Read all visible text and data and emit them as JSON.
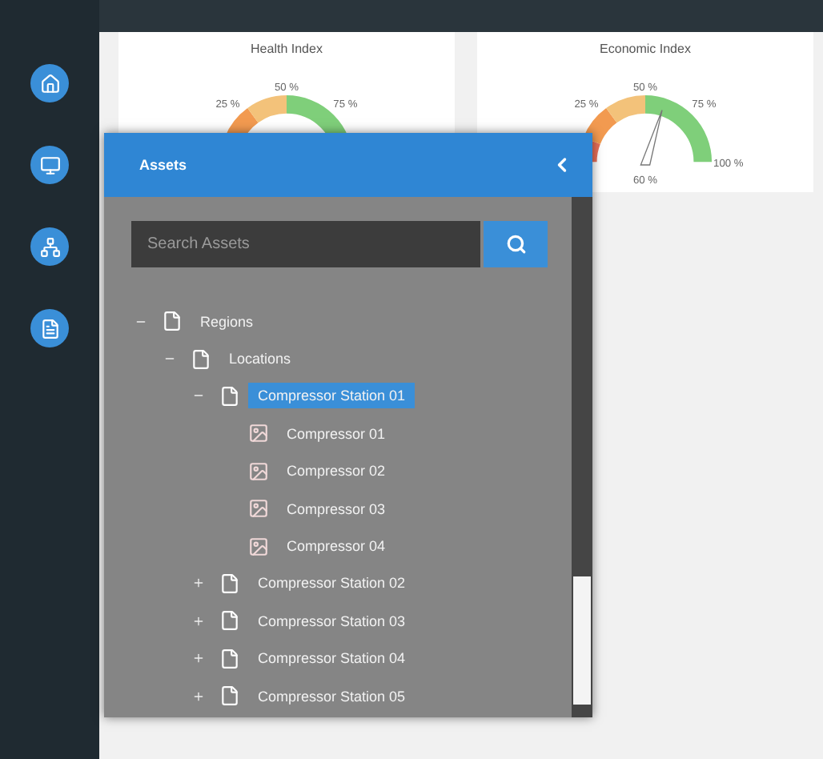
{
  "nav": [
    {
      "selected": false
    },
    {
      "selected": false
    },
    {
      "selected": false
    },
    {
      "selected": false
    }
  ],
  "gauges": [
    {
      "title": "Health Index",
      "ticks": [
        "25 %",
        "50 %",
        "75 %"
      ]
    },
    {
      "title": "Economic Index",
      "ticks": [
        "25 %",
        "50 %",
        "75 %",
        "100 %"
      ],
      "reading": "60 %"
    }
  ],
  "assets_panel": {
    "title": "Assets",
    "search": {
      "placeholder": "Search Assets"
    },
    "tree": [
      {
        "label": "Regions",
        "kind": "folder",
        "expanded": true,
        "selected": false,
        "children": [
          {
            "label": "Locations",
            "kind": "folder",
            "expanded": true,
            "selected": false,
            "children": [
              {
                "label": "Compressor Station 01",
                "kind": "folder",
                "expanded": true,
                "selected": true,
                "children": [
                  {
                    "label": "Compressor 01",
                    "kind": "asset",
                    "selected": false
                  },
                  {
                    "label": "Compressor 02",
                    "kind": "asset",
                    "selected": false
                  },
                  {
                    "label": "Compressor 03",
                    "kind": "asset",
                    "selected": false
                  },
                  {
                    "label": "Compressor 04",
                    "kind": "asset",
                    "selected": false
                  }
                ]
              },
              {
                "label": "Compressor Station 02",
                "kind": "folder",
                "expanded": false,
                "selected": false
              },
              {
                "label": "Compressor Station 03",
                "kind": "folder",
                "expanded": false,
                "selected": false
              },
              {
                "label": "Compressor Station 04",
                "kind": "folder",
                "expanded": false,
                "selected": false
              },
              {
                "label": "Compressor Station 05",
                "kind": "folder",
                "expanded": false,
                "selected": false
              }
            ]
          }
        ]
      }
    ]
  }
}
